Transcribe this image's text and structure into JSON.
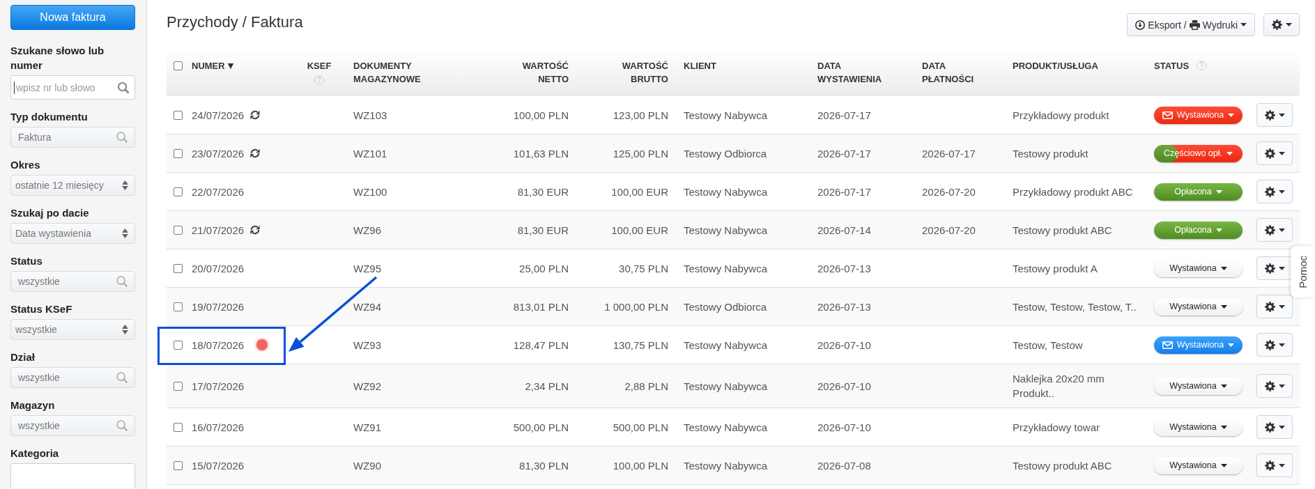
{
  "sidebar": {
    "new_invoice_button": "Nowa faktura",
    "filters": [
      {
        "label": "Szukane słowo lub numer",
        "kind": "text",
        "placeholder": "wpisz nr lub słowo",
        "focused": true
      },
      {
        "label": "Typ dokumentu",
        "kind": "search",
        "value": "Faktura",
        "focused": false
      },
      {
        "label": "Okres",
        "kind": "select",
        "value": "ostatnie 12 miesięcy",
        "focused": false
      },
      {
        "label": "Szukaj po dacie",
        "kind": "select",
        "value": "Data wystawienia",
        "focused": false
      },
      {
        "label": "Status",
        "kind": "search",
        "value": "wszystkie",
        "focused": false
      },
      {
        "label": "Status KSeF",
        "kind": "select",
        "value": "wszystkie",
        "focused": false
      },
      {
        "label": "Dział",
        "kind": "search",
        "value": "wszystkie",
        "focused": false
      },
      {
        "label": "Magazyn",
        "kind": "search",
        "value": "wszystkie",
        "focused": false
      },
      {
        "label": "Kategoria",
        "kind": "textarea",
        "focused": false
      }
    ]
  },
  "header": {
    "title": "Przychody / Faktura",
    "export_label": "Eksport /",
    "print_label": "Wydruki"
  },
  "table": {
    "select_all_checked": false,
    "columns": [
      {
        "label": "NUMER",
        "sort_indicator": "▼"
      },
      {
        "label": "KSEF",
        "help_mark": "?"
      },
      {
        "label": "DOKUMENTY MAGAZYNOWE"
      },
      {
        "label": "WARTOŚĆ NETTO"
      },
      {
        "label": "WARTOŚĆ BRUTTO"
      },
      {
        "label": "KLIENT"
      },
      {
        "label": "DATA WYSTAWIENIA"
      },
      {
        "label": "DATA PŁATNOŚCI"
      },
      {
        "label": "PRODUKT/USŁUGA"
      },
      {
        "label": "STATUS",
        "help_mark": "?"
      }
    ],
    "rows": [
      {
        "checked": false,
        "number": "24/07/2026",
        "sync": true,
        "annotated": false,
        "document": "WZ103",
        "net": "100,00 PLN",
        "gross": "123,00 PLN",
        "client": "Testowy Nabywca",
        "issue_date": "2026-07-17",
        "product": "Przykładowy produkt",
        "status": {
          "label": "Wystawiona",
          "kind": "overdue",
          "mailed": true
        }
      },
      {
        "checked": false,
        "number": "23/07/2026",
        "sync": true,
        "annotated": false,
        "document": "WZ101",
        "net": "101,63 PLN",
        "gross": "125,00 PLN",
        "client": "Testowy Odbiorca",
        "issue_date": "2026-07-17",
        "payment_date": "2026-07-17",
        "product": "Testowy produkt",
        "status": {
          "label": "Częściowo opł.",
          "kind": "partial",
          "mailed": false,
          "level": 0.27
        }
      },
      {
        "checked": false,
        "number": "22/07/2026",
        "sync": false,
        "annotated": false,
        "document": "WZ100",
        "net": "81,30 EUR",
        "gross": "100,00 EUR",
        "client": "Testowy Nabywca",
        "issue_date": "2026-07-17",
        "payment_date": "2026-07-20",
        "product": "Przykładowy produkt ABC",
        "status": {
          "label": "Opłacona",
          "kind": "paid",
          "mailed": false
        }
      },
      {
        "checked": false,
        "number": "21/07/2026",
        "sync": true,
        "annotated": false,
        "document": "WZ96",
        "net": "81,30 EUR",
        "gross": "100,00 EUR",
        "client": "Testowy Nabywca",
        "issue_date": "2026-07-14",
        "payment_date": "2026-07-20",
        "product": "Testowy produkt ABC",
        "status": {
          "label": "Opłacona",
          "kind": "paid",
          "mailed": false
        }
      },
      {
        "checked": false,
        "number": "20/07/2026",
        "sync": false,
        "annotated": false,
        "document": "WZ95",
        "net": "25,00 PLN",
        "gross": "30,75 PLN",
        "client": "Testowy Nabywca",
        "issue_date": "2026-07-13",
        "product": "Testowy produkt A",
        "status": {
          "label": "Wystawiona",
          "kind": "issued",
          "mailed": false
        }
      },
      {
        "checked": false,
        "number": "19/07/2026",
        "sync": false,
        "annotated": false,
        "document": "WZ94",
        "net": "813,01 PLN",
        "gross": "1 000,00 PLN",
        "client": "Testowy Odbiorca",
        "issue_date": "2026-07-13",
        "product": "Testow, Testow, Testow, T..",
        "status": {
          "label": "Wystawiona",
          "kind": "issued",
          "mailed": false
        }
      },
      {
        "checked": false,
        "number": "18/07/2026",
        "sync": false,
        "annotated": true,
        "document": "WZ93",
        "net": "128,47 PLN",
        "gross": "130,75 PLN",
        "client": "Testowy Nabywca",
        "issue_date": "2026-07-10",
        "product": "Testow, Testow",
        "status": {
          "label": "Wystawiona",
          "kind": "sent",
          "mailed": true
        }
      },
      {
        "checked": false,
        "number": "17/07/2026",
        "sync": false,
        "annotated": false,
        "document": "WZ92",
        "net": "2,34 PLN",
        "gross": "2,88 PLN",
        "client": "Testowy Nabywca",
        "issue_date": "2026-07-10",
        "product": "Naklejka 20x20 mm Produkt..",
        "status": {
          "label": "Wystawiona",
          "kind": "issued",
          "mailed": false
        }
      },
      {
        "checked": false,
        "number": "16/07/2026",
        "sync": false,
        "annotated": false,
        "document": "WZ91",
        "net": "500,00 PLN",
        "gross": "500,00 PLN",
        "client": "Testowy Nabywca",
        "issue_date": "2026-07-10",
        "product": "Przykładowy towar",
        "status": {
          "label": "Wystawiona",
          "kind": "issued",
          "mailed": false
        }
      },
      {
        "checked": false,
        "number": "15/07/2026",
        "sync": false,
        "annotated": false,
        "document": "WZ90",
        "net": "81,30 PLN",
        "gross": "100,00 PLN",
        "client": "Testowy Nabywca",
        "issue_date": "2026-07-08",
        "product": "Testowy produkt ABC",
        "status": {
          "label": "Wystawiona",
          "kind": "issued",
          "mailed": false
        }
      }
    ]
  },
  "help_tab": {
    "label": "Pomoc"
  }
}
